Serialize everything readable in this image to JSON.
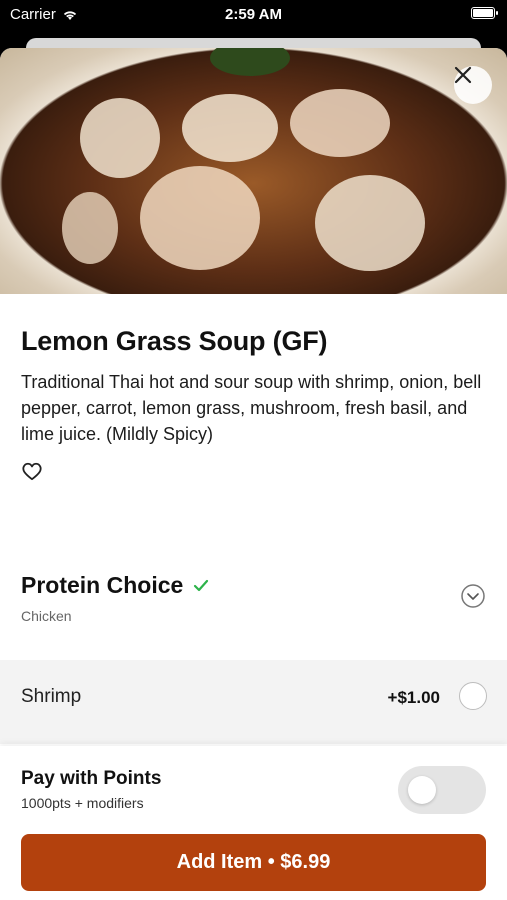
{
  "status_bar": {
    "carrier": "Carrier",
    "time": "2:59 AM",
    "icons": [
      "wifi-icon",
      "battery-icon"
    ]
  },
  "item": {
    "title": "Lemon Grass Soup (GF)",
    "description": "Traditional Thai hot and sour soup with shrimp, onion, bell pepper, carrot, lemon grass, mushroom, fresh basil, and lime juice. (Mildly Spicy)",
    "favorite_icon": "heart-outline-icon",
    "close_icon": "close-icon"
  },
  "protein": {
    "title": "Protein Choice",
    "selected": "Chicken",
    "check_icon": "checkmark-icon",
    "expand_icon": "chevron-down-circle-icon",
    "options": [
      {
        "label": "Shrimp",
        "price": "+$1.00"
      }
    ]
  },
  "points": {
    "title": "Pay with Points",
    "subtitle": "1000pts + modifiers",
    "enabled": false
  },
  "cta": {
    "label": "Add Item • $6.99"
  },
  "colors": {
    "accent": "#b3410d",
    "check": "#2db34a",
    "option_bg": "#f3f3f3"
  }
}
